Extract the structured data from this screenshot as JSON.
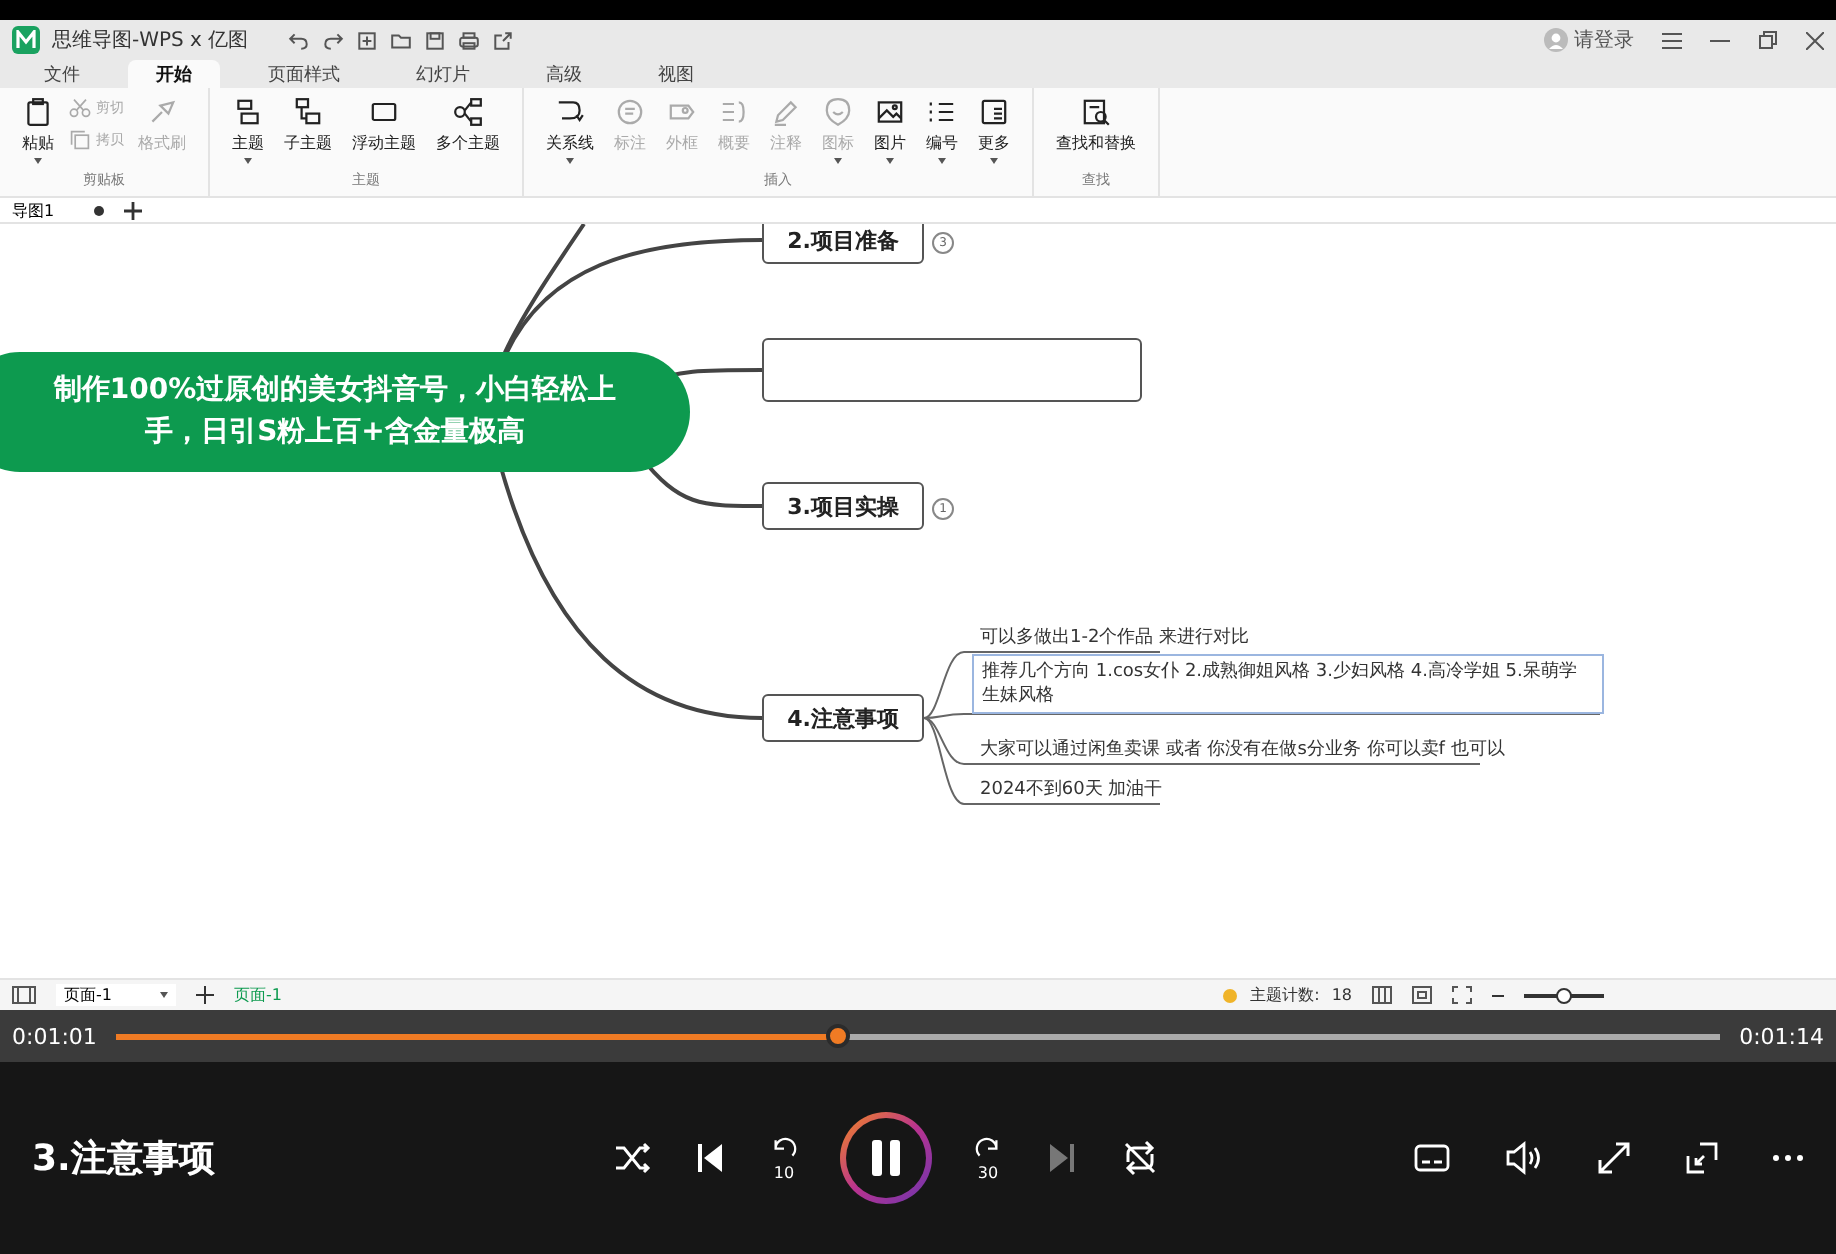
{
  "app": {
    "title": "思维导图-WPS x 亿图",
    "login": "请登录",
    "menu_tabs": [
      {
        "label": "文件",
        "selected": false
      },
      {
        "label": "开始",
        "selected": true
      },
      {
        "label": "页面样式",
        "selected": false
      },
      {
        "label": "幻灯片",
        "selected": false
      },
      {
        "label": "高级",
        "selected": false
      },
      {
        "label": "视图",
        "selected": false
      }
    ],
    "ribbon": [
      {
        "label": "剪贴板",
        "items": [
          {
            "label": "粘贴",
            "kind": "large",
            "disabled": false,
            "dropdown": true
          },
          {
            "label": "剪切",
            "kind": "small",
            "disabled": true,
            "dropdown": false
          },
          {
            "label": "拷贝",
            "kind": "small",
            "disabled": true,
            "dropdown": false
          },
          {
            "label": "格式刷",
            "kind": "large",
            "disabled": true,
            "dropdown": false
          }
        ]
      },
      {
        "label": "主题",
        "items": [
          {
            "label": "主题",
            "kind": "large",
            "disabled": false,
            "dropdown": true
          },
          {
            "label": "子主题",
            "kind": "large",
            "disabled": false,
            "dropdown": false
          },
          {
            "label": "浮动主题",
            "kind": "large",
            "disabled": false,
            "dropdown": false
          },
          {
            "label": "多个主题",
            "kind": "large",
            "disabled": false,
            "dropdown": false
          }
        ]
      },
      {
        "label": "插入",
        "items": [
          {
            "label": "关系线",
            "kind": "large",
            "disabled": false,
            "dropdown": true
          },
          {
            "label": "标注",
            "kind": "large",
            "disabled": true,
            "dropdown": false
          },
          {
            "label": "外框",
            "kind": "large",
            "disabled": true,
            "dropdown": false
          },
          {
            "label": "概要",
            "kind": "large",
            "disabled": true,
            "dropdown": false
          },
          {
            "label": "注释",
            "kind": "large",
            "disabled": true,
            "dropdown": false
          },
          {
            "label": "图标",
            "kind": "large",
            "disabled": true,
            "dropdown": true
          },
          {
            "label": "图片",
            "kind": "large",
            "disabled": false,
            "dropdown": true
          },
          {
            "label": "编号",
            "kind": "large",
            "disabled": false,
            "dropdown": true
          },
          {
            "label": "更多",
            "kind": "large",
            "disabled": false,
            "dropdown": true
          }
        ]
      },
      {
        "label": "查找",
        "items": [
          {
            "label": "查找和替换",
            "kind": "large",
            "disabled": false,
            "dropdown": false
          }
        ]
      }
    ],
    "doc_tabs": [
      {
        "label": "导图1",
        "modified": true
      }
    ],
    "mindmap": {
      "root": "制作100%过原创的美女抖音号，小白轻松上手，日引S粉上百+含金量极高",
      "topics": [
        {
          "kind": "topic",
          "label": "2.项目准备",
          "badge": "3"
        },
        {
          "kind": "blank"
        },
        {
          "kind": "topic",
          "label": "3.项目实操",
          "badge": "1"
        },
        {
          "kind": "topic",
          "label": "4.注意事项",
          "children": [
            {
              "text": "可以多做出1-2个作品  来进行对比",
              "selected": false
            },
            {
              "text": "推荐几个方向  1.cos女仆   2.成熟御姐风格   3.少妇风格  4.高冷学姐   5.呆萌学生妹风格",
              "selected": true
            },
            {
              "text": "大家可以通过闲鱼卖课  或者  你没有在做s分业务 你可以卖f  也可以",
              "selected": false
            },
            {
              "text": "2024不到60天  加油干",
              "selected": false
            }
          ]
        }
      ]
    },
    "status_bar": {
      "page_selector": "页面-1",
      "pages": [
        {
          "label": "页面-1",
          "selected": true
        }
      ],
      "topic_count_label": "主题计数:",
      "topic_count": "18",
      "zoom": {
        "level": 0.5
      }
    }
  },
  "player": {
    "elapsed": "0:01:01",
    "total": "0:01:14",
    "progress": {
      "level": 0.45
    },
    "title": "3.注意事项",
    "skip_back": "10",
    "skip_forward": "30",
    "playing": true,
    "next_disabled": true
  }
}
